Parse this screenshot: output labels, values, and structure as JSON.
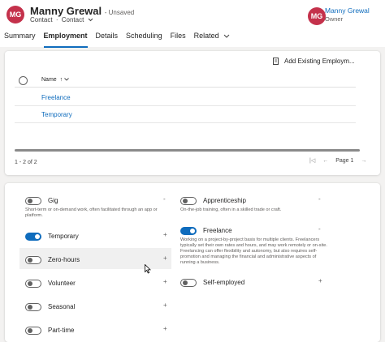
{
  "record": {
    "avatar_initials": "MG",
    "title": "Manny Grewal",
    "status": "- Unsaved",
    "entity": "Contact",
    "separator": "·",
    "form": "Contact"
  },
  "owner": {
    "avatar_initials": "MG",
    "name": "Manny Grewal",
    "role": "Owner"
  },
  "tabs": [
    {
      "label": "Summary"
    },
    {
      "label": "Employment",
      "active": true
    },
    {
      "label": "Details"
    },
    {
      "label": "Scheduling"
    },
    {
      "label": "Files"
    },
    {
      "label": "Related"
    }
  ],
  "subgrid": {
    "toolbar_button": "Add Existing Employm...",
    "column_name": "Name",
    "sort_indicator": "↑",
    "rows": [
      "Freelance",
      "Temporary"
    ],
    "record_count": "1 - 2 of 2",
    "page_label": "Page 1"
  },
  "options_left": [
    {
      "label": "Gig",
      "on": false,
      "mark": "-",
      "desc": [
        "Short-term or on-demand work, often facilitated through an app or",
        "platform."
      ]
    },
    {
      "label": "Temporary",
      "on": true,
      "mark": "+"
    },
    {
      "label": "Zero-hours",
      "on": false,
      "mark": "+"
    },
    {
      "label": "Volunteer",
      "on": false,
      "mark": "+"
    },
    {
      "label": "Seasonal",
      "on": false,
      "mark": "+"
    },
    {
      "label": "Part-time",
      "on": false,
      "mark": "+"
    }
  ],
  "options_right": [
    {
      "label": "Apprenticeship",
      "on": false,
      "mark": "-",
      "desc": [
        "On-the-job training, often in a skilled trade or craft."
      ]
    },
    {
      "label": "Freelance",
      "on": true,
      "mark": "-",
      "desc": [
        "Working on a project-by-project basis for multiple clients. Freelancers",
        "typically set their own rates and hours, and may work remotely or on-site.",
        "Freelancing can offer flexibility and autonomy, but also requires self-",
        "promotion and managing the financial and administrative aspects of",
        "running a business."
      ]
    },
    {
      "label": "Self-employed",
      "on": false,
      "mark": "+"
    }
  ],
  "colors": {
    "accent": "#0f6cbd",
    "avatar": "#c4314b",
    "background": "#f3f2f1"
  }
}
